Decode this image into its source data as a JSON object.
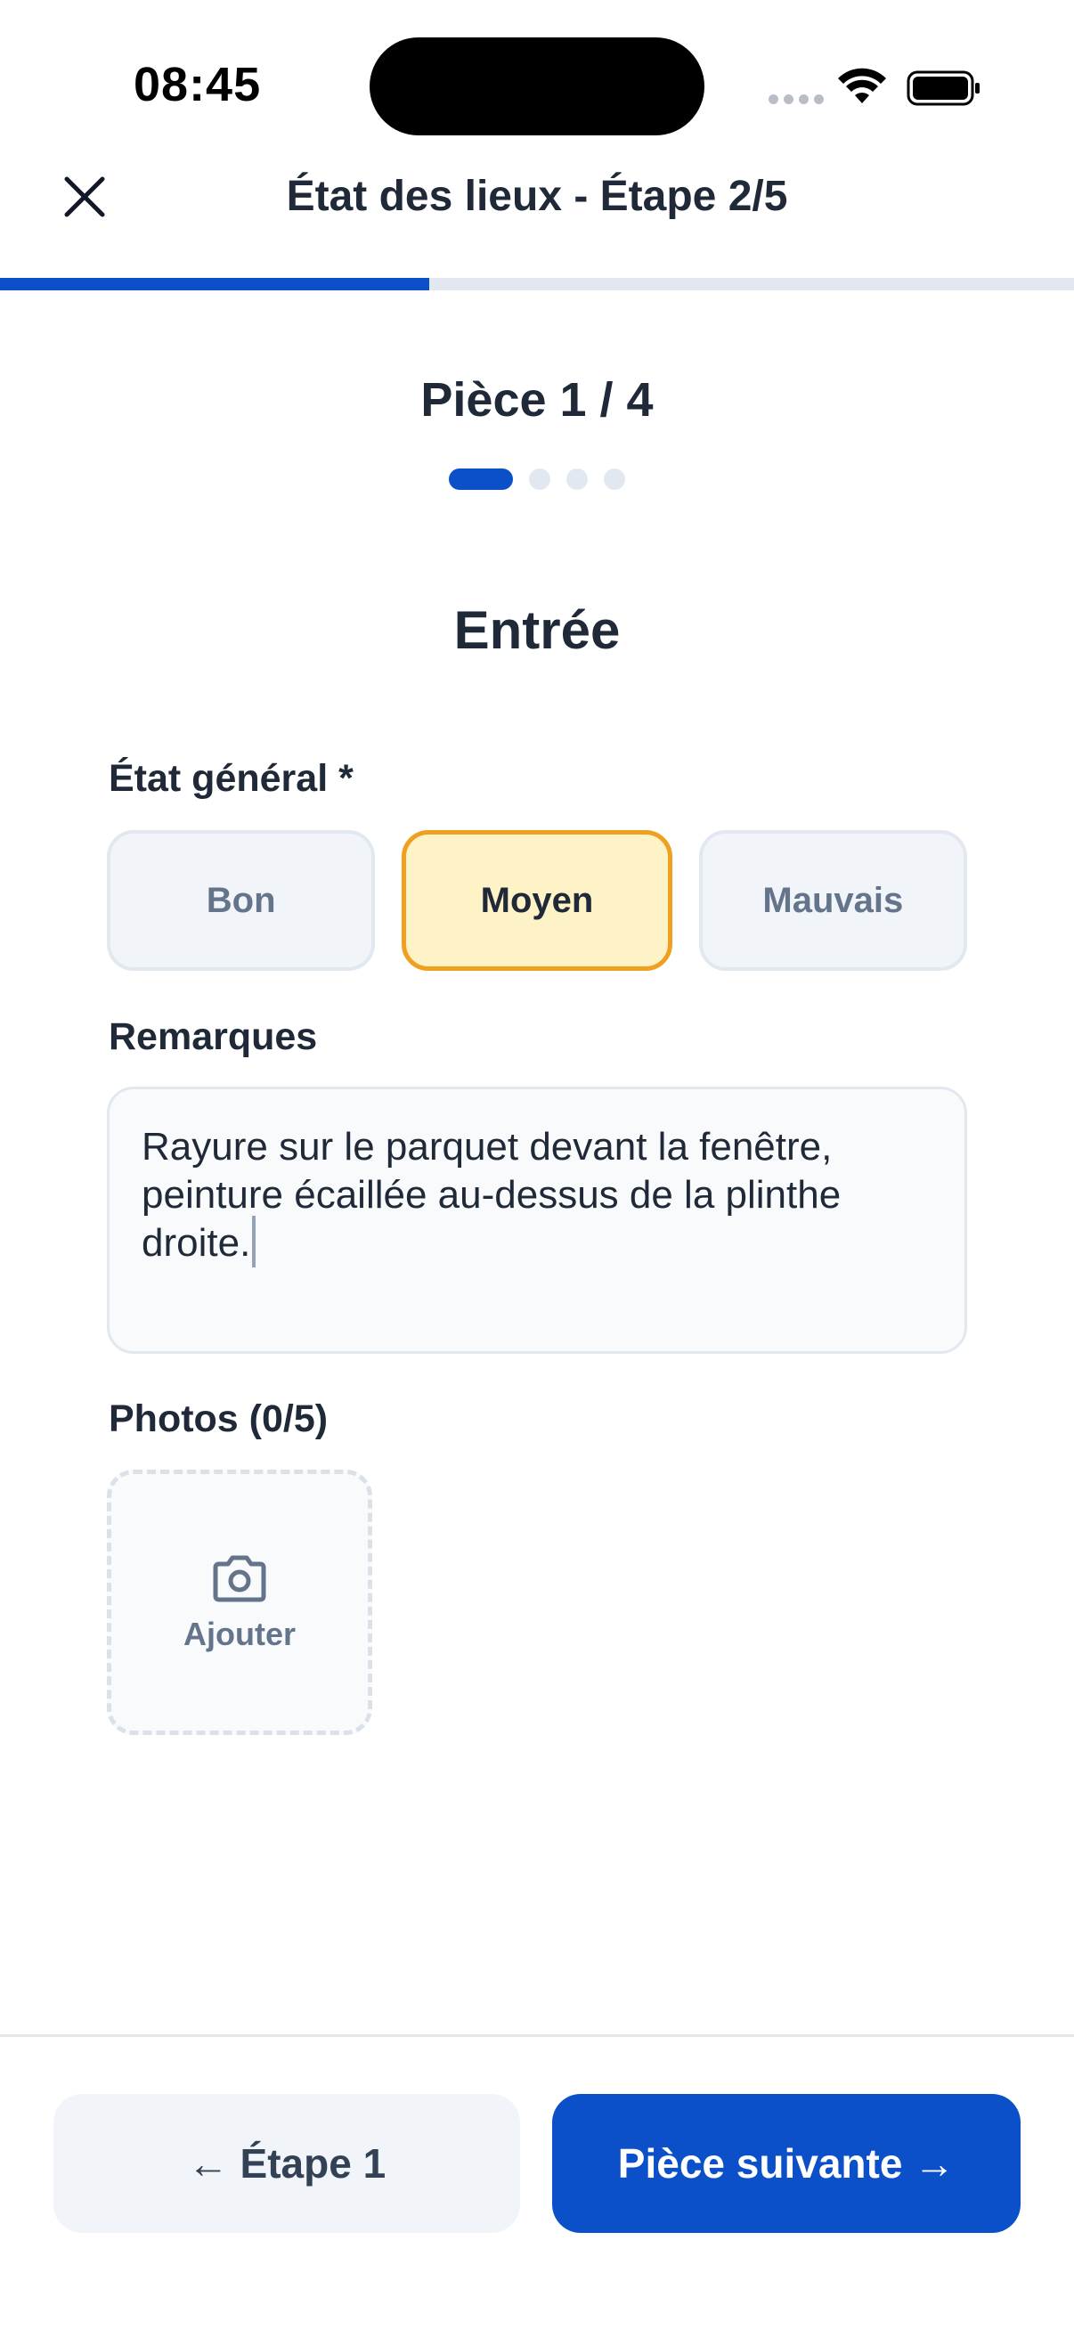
{
  "status_bar": {
    "time": "08:45"
  },
  "header": {
    "title": "État des lieux - Étape 2/5",
    "close_icon": "close-icon"
  },
  "progress": {
    "step": 2,
    "total_steps": 5,
    "fraction": 0.4,
    "accent_color": "#0b50c8"
  },
  "room_pager": {
    "counter": "Pièce 1 / 4",
    "current": 1,
    "total": 4
  },
  "room": {
    "name": "Entrée"
  },
  "condition": {
    "label": "État général *",
    "options": [
      "Bon",
      "Moyen",
      "Mauvais"
    ],
    "selected": "Moyen"
  },
  "remarks": {
    "label": "Remarques",
    "value": "Rayure sur le parquet devant la fenêtre, peinture écaillée au-dessus de la plinthe droite."
  },
  "photos": {
    "label": "Photos (0/5)",
    "add_label": "Ajouter",
    "add_icon": "camera-icon"
  },
  "footer": {
    "prev_label": "← Étape 1",
    "next_label": "Pièce suivante →",
    "next_color": "#0b50c8"
  }
}
